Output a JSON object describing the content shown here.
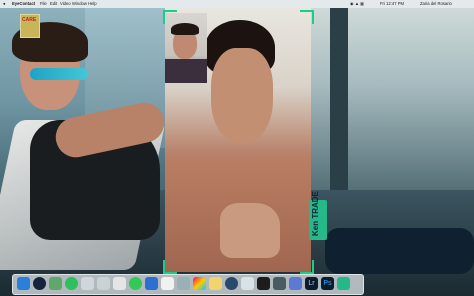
{
  "menubar": {
    "app_name": "EyeContact",
    "menus": [
      "File",
      "Edit",
      "Video",
      "Window",
      "Help"
    ],
    "clock": "Fri 12:47 PM",
    "user": "Zaria del Rosario"
  },
  "call": {
    "caller_name": "Ken TRADE"
  },
  "logo": {
    "text": "CARE"
  },
  "dock": {
    "icons": [
      "finder-icon",
      "night-icon",
      "triangle-icon",
      "messages-icon",
      "screen-icon",
      "maps-icon",
      "photos-icon",
      "check-icon",
      "share-icon",
      "notes-icon",
      "finder2-icon",
      "colors-icon",
      "time-icon",
      "circle-icon",
      "list-icon",
      "terminal-icon",
      "camera-icon",
      "grid-icon",
      "lightroom-icon",
      "photoshop-icon",
      "teal-icon"
    ]
  },
  "dock_labels": {
    "lightroom": "Lr",
    "photoshop": "Ps"
  },
  "colors": {
    "accent": "#16d08a",
    "name_tag": "#27b88a"
  }
}
